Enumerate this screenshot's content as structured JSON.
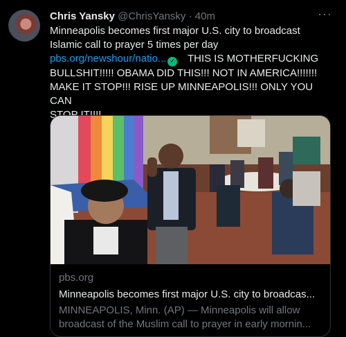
{
  "tweet": {
    "author_name": "Chris Yansky",
    "handle": "@ChrisYansky",
    "separator": "·",
    "time": "40m",
    "more": "···",
    "text_line1": "Minneapolis becomes first major U.S. city to broadcast",
    "text_line2": "Islamic call to prayer 5 times per day",
    "link": "pbs.org/newshour/natio...",
    "verified": "✓",
    "text_after_link": "THIS IS MOTHERFUCKING",
    "text_line4": "BULLSHIT!!!!! OBAMA DID THIS!!! NOT IN AMERICA!!!!!!!",
    "text_line5": "MAKE IT STOP!!! RISE UP MINNEAPOLIS!!! ONLY YOU CAN",
    "text_line6": "STOP IT!!!!"
  },
  "card": {
    "domain": "pbs.org",
    "title": "Minneapolis becomes first major U.S. city to broadcas...",
    "desc_line1": "MINNEAPOLIS, Minn. (AP) — Minneapolis will allow",
    "desc_line2": "broadcast of the Muslim call to prayer in early mornin..."
  },
  "colors": {
    "link": "#1d9bf0",
    "verified": "#00ba7c",
    "muted": "#71767b",
    "text": "#e7e9ea"
  }
}
